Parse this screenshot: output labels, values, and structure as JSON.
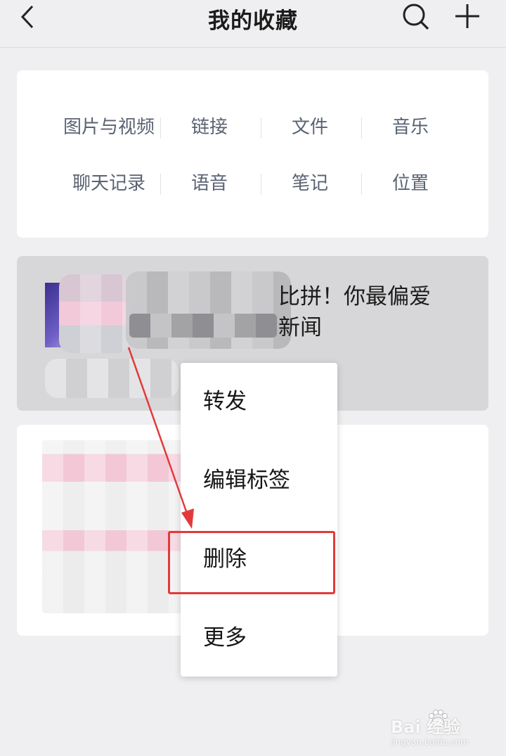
{
  "header": {
    "title": "我的收藏",
    "back_icon": "chevron-left-icon",
    "search_icon": "search-icon",
    "add_icon": "plus-icon"
  },
  "categories": {
    "row1": [
      "图片与视频",
      "链接",
      "文件",
      "音乐"
    ],
    "row2": [
      "聊天记录",
      "语音",
      "笔记",
      "位置"
    ]
  },
  "favorites": [
    {
      "title_line1": "比拼！你最偏爱",
      "title_line2": "新闻"
    }
  ],
  "context_menu": {
    "items": [
      "转发",
      "编辑标签",
      "删除",
      "更多"
    ],
    "highlighted": "删除"
  },
  "annotation": {
    "highlight_color": "#e23a3a"
  },
  "watermark": {
    "brand": "Bai 经验",
    "sub": "jingyan.baidu.com"
  }
}
